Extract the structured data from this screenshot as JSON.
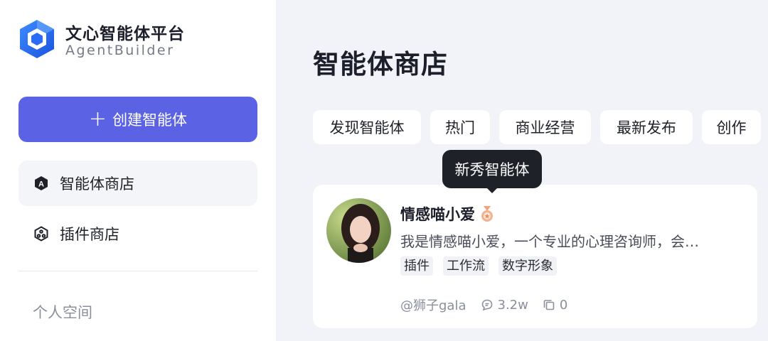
{
  "brand": {
    "title": "文心智能体平台",
    "subtitle": "AgentBuilder",
    "accent": "#2a6cf6"
  },
  "sidebar": {
    "create_label": "创建智能体",
    "items": [
      {
        "label": "智能体商店",
        "icon": "agent-store-icon",
        "active": true
      },
      {
        "label": "插件商店",
        "icon": "plugin-store-icon",
        "active": false
      }
    ],
    "section_label": "个人空间"
  },
  "main": {
    "title": "智能体商店",
    "tabs": [
      {
        "label": "发现智能体"
      },
      {
        "label": "热门"
      },
      {
        "label": "商业经营"
      },
      {
        "label": "最新发布"
      },
      {
        "label": "创作"
      }
    ],
    "tooltip": "新秀智能体",
    "card": {
      "name": "情感喵小爱",
      "description": "我是情感喵小爱，一个专业的心理咨询师，会…",
      "tags": [
        "插件",
        "工作流",
        "数字形象"
      ],
      "author": "@狮子gala",
      "conversations": "3.2w",
      "copies": "0"
    }
  },
  "colors": {
    "primary_button": "#5b63e4",
    "tooltip_bg": "#1f2129",
    "page_bg": "#f1f3f9"
  }
}
